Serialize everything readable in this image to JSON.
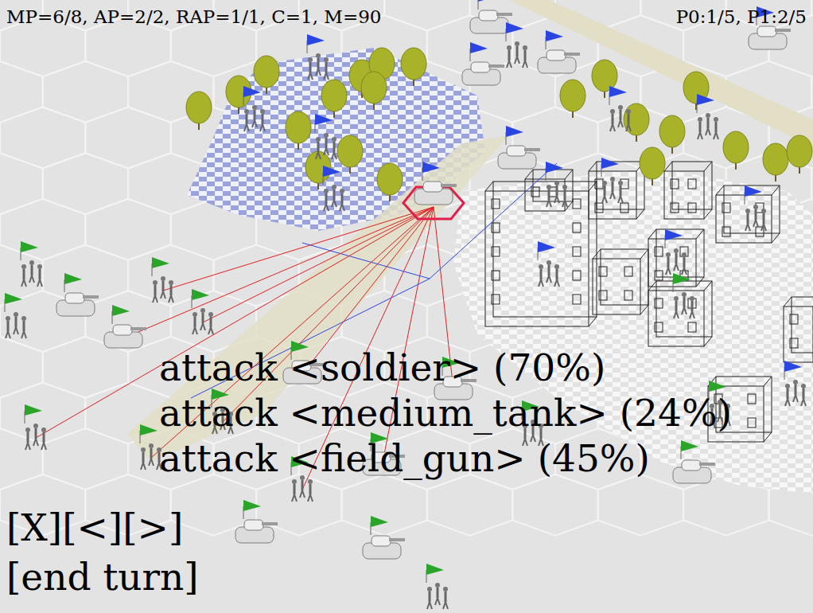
{
  "hud": {
    "stats": "MP=6/8, AP=2/2, RAP=1/1, C=1, M=90",
    "players": "P0:1/5, P1:2/5"
  },
  "action_menu": [
    {
      "label": "attack <soldier> (70%)",
      "selected": false
    },
    {
      "label": "attack <medium_tank> (24%)",
      "selected": false
    },
    {
      "label": "attack <field_gun> (45%)",
      "selected": false
    }
  ],
  "nav_buttons": [
    "[X]",
    "[<]",
    "[>]"
  ],
  "end_turn": "[end turn]",
  "units": [
    {
      "kind": "tank",
      "color": "#2b46e0",
      "selected": true,
      "targeted": false
    },
    {
      "kind": "tank",
      "color": "#2b46e0",
      "selected": false,
      "targeted": false
    },
    {
      "kind": "tank",
      "color": "#2b46e0",
      "selected": false,
      "targeted": false
    },
    {
      "kind": "tank",
      "color": "#2b46e0",
      "selected": false,
      "targeted": false
    },
    {
      "kind": "soldier",
      "color": "#2b46e0",
      "selected": false,
      "targeted": false
    },
    {
      "kind": "soldier",
      "color": "#2b46e0",
      "selected": false,
      "targeted": false
    },
    {
      "kind": "soldier",
      "color": "#2b46e0",
      "selected": false,
      "targeted": false
    },
    {
      "kind": "soldier",
      "color": "#2b46e0",
      "selected": false,
      "targeted": false
    },
    {
      "kind": "soldier",
      "color": "#2b46e0",
      "selected": false,
      "targeted": false
    },
    {
      "kind": "soldier",
      "color": "#2b46e0",
      "selected": false,
      "targeted": false
    },
    {
      "kind": "soldier",
      "color": "#2b46e0",
      "selected": false,
      "targeted": false
    },
    {
      "kind": "tank",
      "color": "#2b46e0",
      "selected": false,
      "targeted": false
    },
    {
      "kind": "soldier",
      "color": "#2b46e0",
      "selected": false,
      "targeted": false
    },
    {
      "kind": "soldier",
      "color": "#2b46e0",
      "selected": false,
      "targeted": false
    },
    {
      "kind": "soldier",
      "color": "#2b46e0",
      "selected": false,
      "targeted": false
    },
    {
      "kind": "soldier",
      "color": "#2b46e0",
      "selected": false,
      "targeted": false
    },
    {
      "kind": "soldier",
      "color": "#2b46e0",
      "selected": false,
      "targeted": false
    },
    {
      "kind": "tank",
      "color": "#2b46e0",
      "selected": false,
      "targeted": false
    },
    {
      "kind": "soldier",
      "color": "#2b46e0",
      "selected": false,
      "targeted": false
    },
    {
      "kind": "soldier",
      "color": "#2aa52a",
      "selected": false,
      "targeted": false
    },
    {
      "kind": "tank",
      "color": "#2aa52a",
      "selected": false,
      "targeted": false
    },
    {
      "kind": "soldier",
      "color": "#2aa52a",
      "selected": false,
      "targeted": true
    },
    {
      "kind": "soldier",
      "color": "#2aa52a",
      "selected": false,
      "targeted": true
    },
    {
      "kind": "tank",
      "color": "#2aa52a",
      "selected": false,
      "targeted": true
    },
    {
      "kind": "soldier",
      "color": "#2aa52a",
      "selected": false,
      "targeted": false
    },
    {
      "kind": "tank",
      "color": "#2aa52a",
      "selected": false,
      "targeted": true
    },
    {
      "kind": "soldier",
      "color": "#2aa52a",
      "selected": false,
      "targeted": true
    },
    {
      "kind": "soldier",
      "color": "#2aa52a",
      "selected": false,
      "targeted": true
    },
    {
      "kind": "soldier",
      "color": "#2aa52a",
      "selected": false,
      "targeted": true
    },
    {
      "kind": "tank",
      "color": "#2aa52a",
      "selected": false,
      "targeted": true
    },
    {
      "kind": "soldier",
      "color": "#2aa52a",
      "selected": false,
      "targeted": true
    },
    {
      "kind": "tank",
      "color": "#2aa52a",
      "selected": false,
      "targeted": false
    },
    {
      "kind": "tank",
      "color": "#2aa52a",
      "selected": false,
      "targeted": false
    },
    {
      "kind": "soldier",
      "color": "#2aa52a",
      "selected": false,
      "targeted": false
    },
    {
      "kind": "tank",
      "color": "#2aa52a",
      "selected": false,
      "targeted": true
    },
    {
      "kind": "soldier",
      "color": "#2aa52a",
      "selected": false,
      "targeted": false
    },
    {
      "kind": "tank",
      "color": "#2aa52a",
      "selected": false,
      "targeted": false
    },
    {
      "kind": "soldier",
      "color": "#2aa52a",
      "selected": false,
      "targeted": false
    },
    {
      "kind": "soldier",
      "color": "#2aa52a",
      "selected": false,
      "targeted": false
    }
  ]
}
